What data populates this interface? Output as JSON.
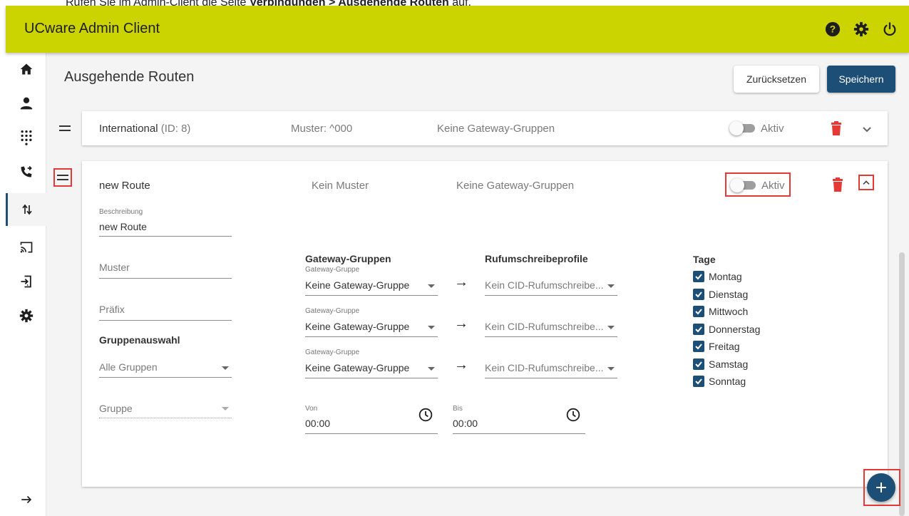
{
  "caption": {
    "prefix": "Rufen Sie im Admin-Client die Seite ",
    "path": "Verbindungen > Ausgehende Routen",
    "suffix": " auf."
  },
  "app": {
    "title": "UCware Admin Client"
  },
  "header_icons": [
    "help-icon",
    "gear-icon",
    "power-icon"
  ],
  "sidebar": {
    "items": [
      {
        "icon": "home-icon"
      },
      {
        "icon": "user-icon"
      },
      {
        "icon": "dialpad-icon"
      },
      {
        "icon": "phone-forward-icon"
      },
      {
        "icon": "routes-icon",
        "active": true
      },
      {
        "icon": "cast-icon"
      },
      {
        "icon": "provisioning-icon"
      },
      {
        "icon": "gear-icon"
      }
    ],
    "collapse_icon": "arrow-right-icon"
  },
  "page": {
    "title": "Ausgehende Routen",
    "reset_label": "Zurücksetzen",
    "save_label": "Speichern"
  },
  "route1": {
    "name": "International",
    "id_text": "(ID: 8)",
    "pattern": "Muster: ^000",
    "gateways": "Keine Gateway-Gruppen",
    "active_label": "Aktiv"
  },
  "route2": {
    "name": "new Route",
    "pattern": "Kein Muster",
    "gateways": "Keine Gateway-Gruppen",
    "active_label": "Aktiv",
    "description_label": "Beschreibung",
    "description_value": "new Route",
    "pattern_placeholder": "Muster",
    "prefix_placeholder": "Präfix",
    "group_selection_heading": "Gruppenauswahl",
    "group_selection_value": "Alle Gruppen",
    "group_placeholder": "Gruppe",
    "gateway_groups_heading": "Gateway-Gruppen",
    "caller_id_heading": "Rufumschreibeprofile",
    "gateway_rows": [
      {
        "label": "Gateway-Gruppe",
        "value": "Keine Gateway-Gruppe",
        "cid": "Kein CID-Rufumschreibe..."
      },
      {
        "label": "Gateway-Gruppe",
        "value": "Keine Gateway-Gruppe",
        "cid": "Kein CID-Rufumschreibe..."
      },
      {
        "label": "Gateway-Gruppe",
        "value": "Keine Gateway-Gruppe",
        "cid": "Kein CID-Rufumschreibe..."
      }
    ],
    "from_label": "Von",
    "from_value": "00:00",
    "to_label": "Bis",
    "to_value": "00:00",
    "days_heading": "Tage",
    "days": [
      "Montag",
      "Dienstag",
      "Mittwoch",
      "Donnerstag",
      "Freitag",
      "Samstag",
      "Sonntag"
    ]
  },
  "colors": {
    "header": "#cbd300",
    "primary": "#1d4e75",
    "delete": "#e53935",
    "highlight": "#e53935"
  }
}
